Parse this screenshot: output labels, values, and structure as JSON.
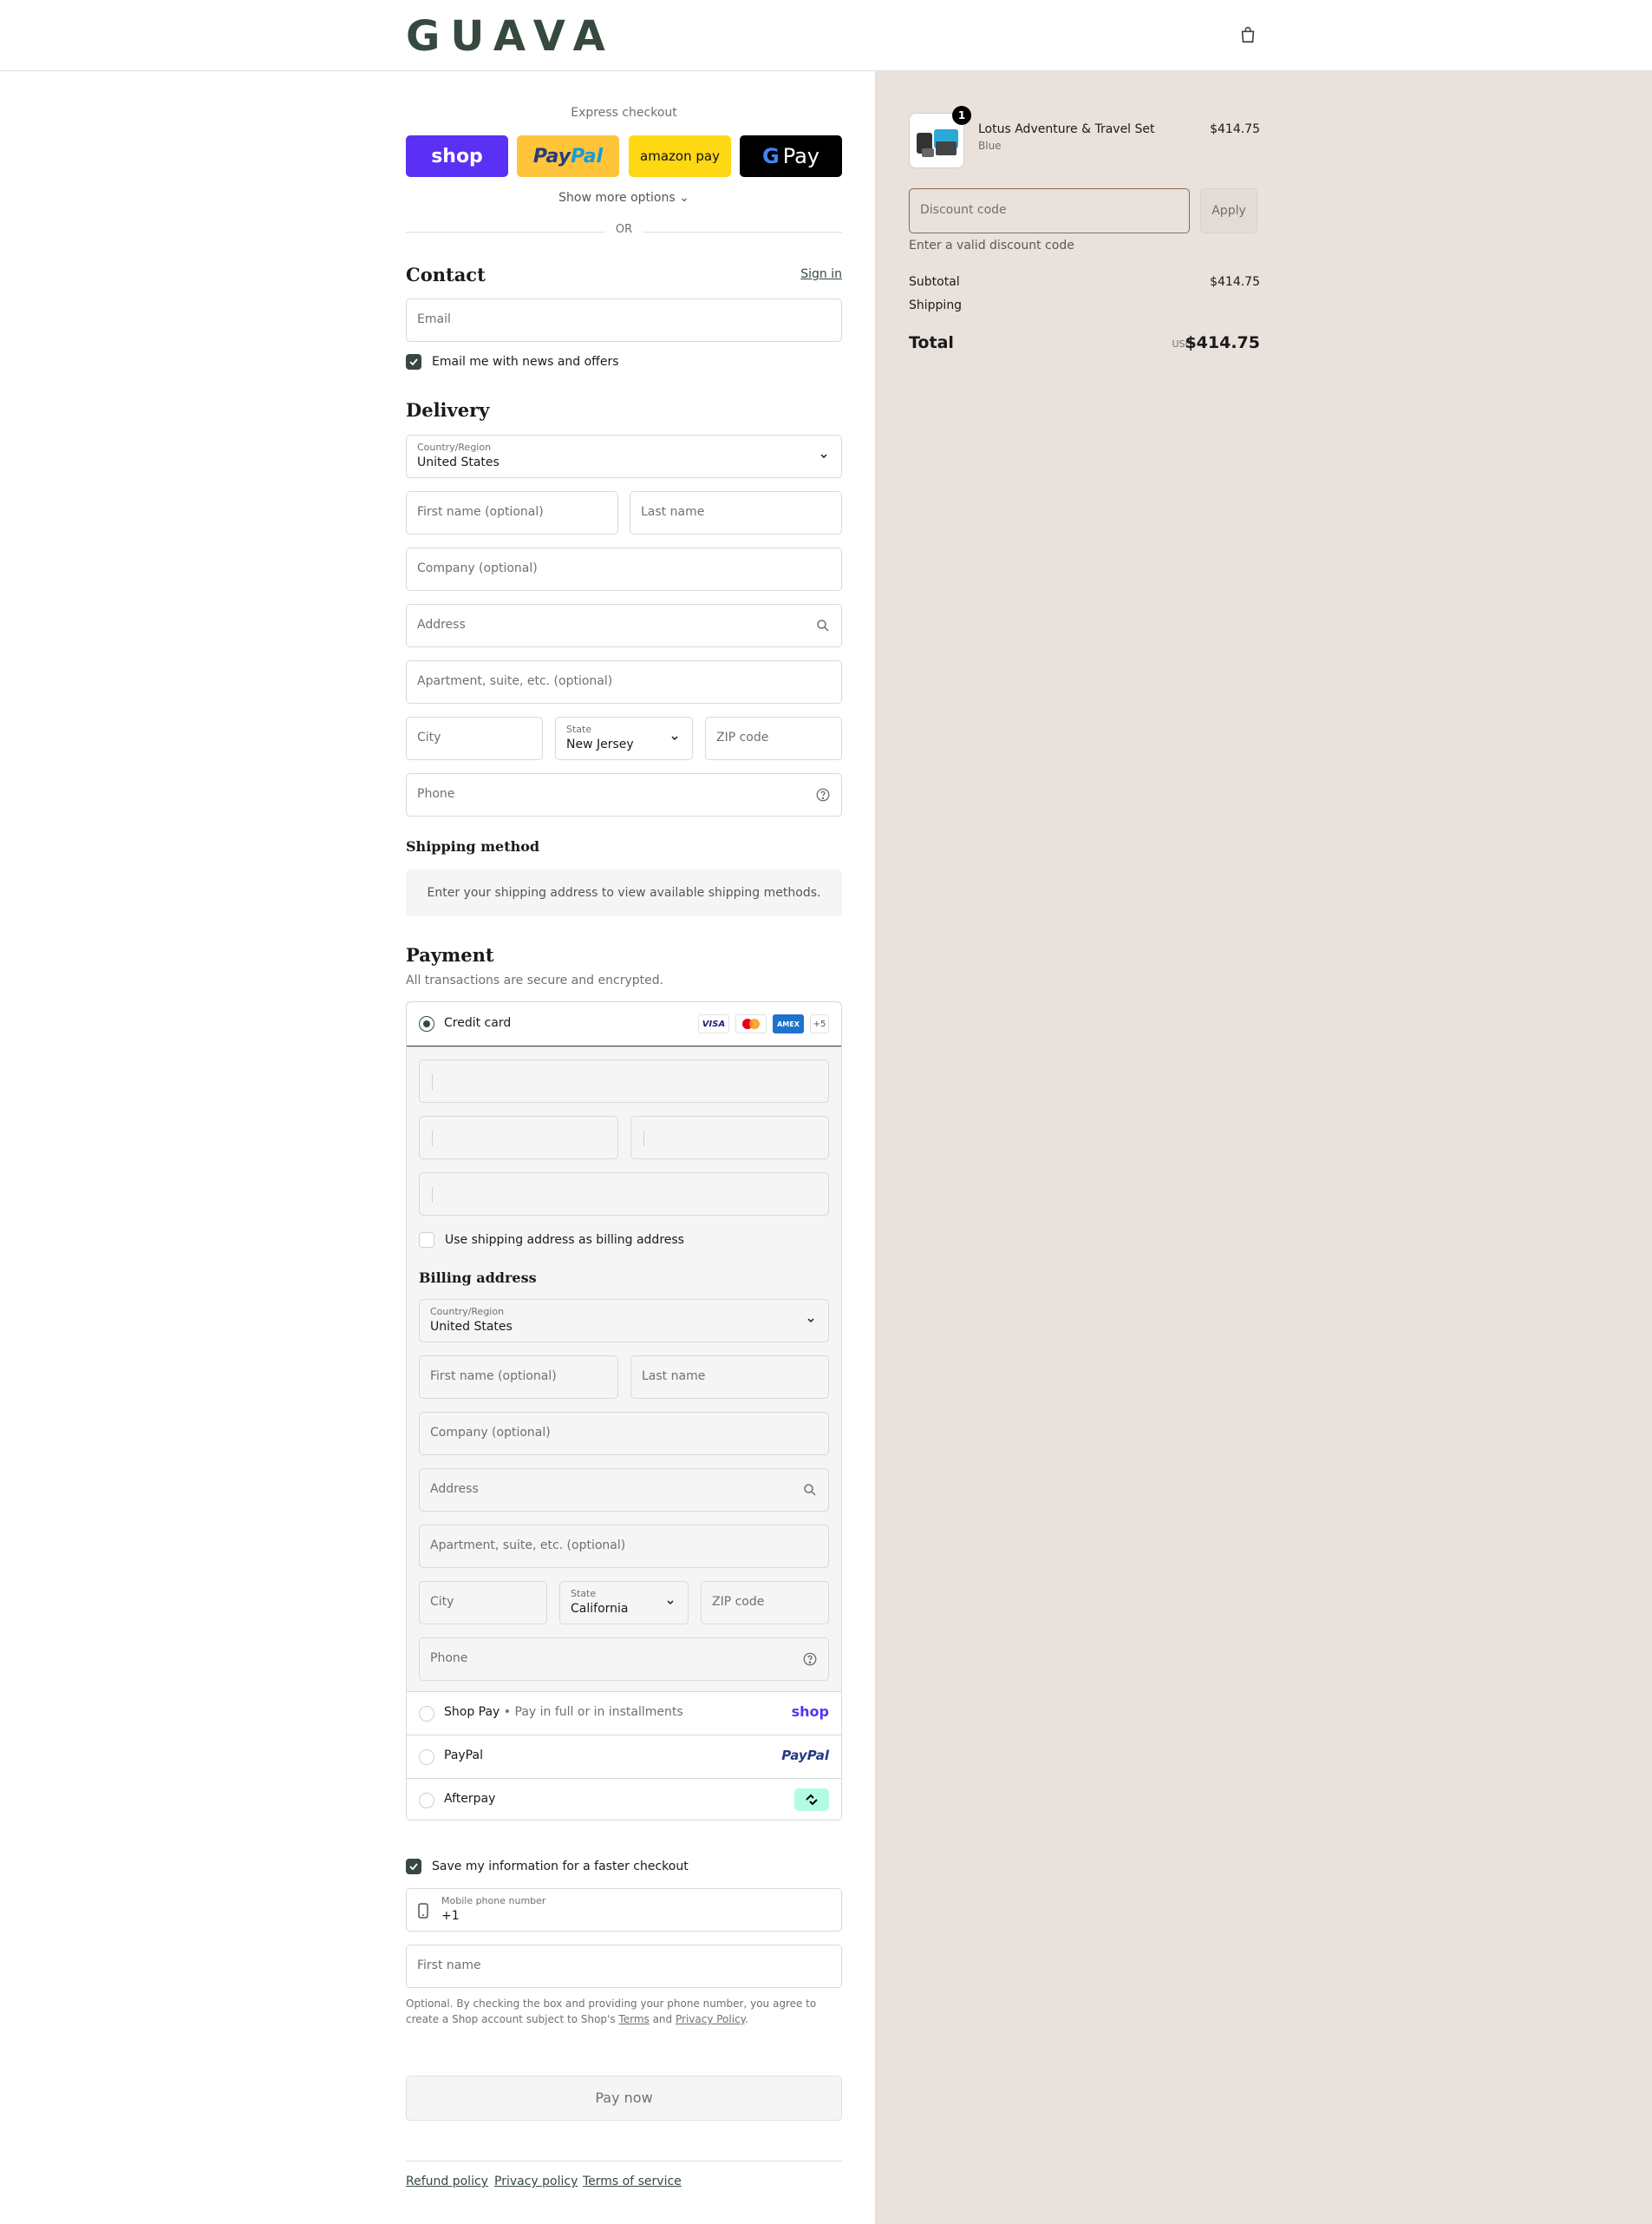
{
  "header": {
    "logo": "GUAVA",
    "cart_icon": "shopping-bag-icon"
  },
  "express": {
    "title": "Express checkout",
    "buttons": {
      "shop": "shop",
      "paypal_a": "Pay",
      "paypal_b": "Pal",
      "amazon": "amazon pay",
      "gpay": "Pay"
    },
    "more_options": "Show more options",
    "or": "OR"
  },
  "contact": {
    "heading": "Contact",
    "sign_in": "Sign in",
    "email_placeholder": "Email",
    "news_label": "Email me with news and offers",
    "news_checked": true
  },
  "delivery": {
    "heading": "Delivery",
    "country_label": "Country/Region",
    "country_value": "United States",
    "first_name": "First name (optional)",
    "last_name": "Last name",
    "company": "Company (optional)",
    "address": "Address",
    "apartment": "Apartment, suite, etc. (optional)",
    "city": "City",
    "state_label": "State",
    "state_value": "New Jersey",
    "zip": "ZIP code",
    "phone": "Phone"
  },
  "shipping": {
    "heading": "Shipping method",
    "message": "Enter your shipping address to view available shipping methods."
  },
  "payment": {
    "heading": "Payment",
    "subtitle": "All transactions are secure and encrypted.",
    "credit_card": "Credit card",
    "card_logos": {
      "visa": "VISA",
      "amex": "AMEX",
      "more": "+5"
    },
    "billing_same": "Use shipping address as billing address",
    "billing_heading": "Billing address",
    "billing": {
      "country_label": "Country/Region",
      "country_value": "United States",
      "first_name": "First name (optional)",
      "last_name": "Last name",
      "company": "Company (optional)",
      "address": "Address",
      "apartment": "Apartment, suite, etc. (optional)",
      "city": "City",
      "state_label": "State",
      "state_value": "California",
      "zip": "ZIP code",
      "phone": "Phone"
    },
    "shop_pay": "Shop Pay",
    "shop_pay_sub": "Pay in full or in installments",
    "shop_pay_logo": "shop",
    "paypal": "PayPal",
    "paypal_logo": "PayPal",
    "afterpay": "Afterpay"
  },
  "remember": {
    "label": "Save my information for a faster checkout",
    "checked": true,
    "phone_label": "Mobile phone number",
    "phone_value": "+1",
    "first_name": "First name",
    "legal_a": "Optional. By checking the box and providing your phone number, you agree to create a Shop account subject to Shop's ",
    "terms": "Terms",
    "and": " and ",
    "privacy": "Privacy Policy",
    "period": "."
  },
  "pay_now": "Pay now",
  "footer": {
    "refund": "Refund policy",
    "privacy": "Privacy policy",
    "terms": "Terms of service"
  },
  "summary": {
    "product": {
      "name": "Lotus Adventure & Travel Set",
      "variant": "Blue",
      "price": "$414.75",
      "quantity": "1"
    },
    "discount_placeholder": "Discount code",
    "apply": "Apply",
    "discount_error": "Enter a valid discount code",
    "subtotal_label": "Subtotal",
    "subtotal": "$414.75",
    "shipping_label": "Shipping",
    "total_label": "Total",
    "currency": "USD",
    "total": "$414.75"
  },
  "colors": {
    "accent": "#36493f",
    "shop_purple": "#5a31f4",
    "paypal_yellow": "#ffc439",
    "amazon_yellow": "#ffd814",
    "summary_bg": "#e9e1dc"
  }
}
